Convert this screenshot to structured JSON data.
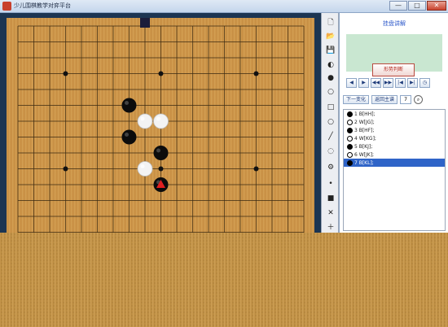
{
  "window": {
    "title": "少儿围棋教学对弈平台",
    "min_label": "—",
    "max_label": "□",
    "close_label": "✕"
  },
  "board": {
    "size": 19,
    "stones": [
      {
        "color": "black",
        "col": 7,
        "row": 5
      },
      {
        "color": "white",
        "col": 8,
        "row": 6
      },
      {
        "color": "white",
        "col": 9,
        "row": 6
      },
      {
        "color": "black",
        "col": 7,
        "row": 7
      },
      {
        "color": "black",
        "col": 9,
        "row": 8
      },
      {
        "color": "white",
        "col": 8,
        "row": 9
      },
      {
        "color": "black",
        "col": 9,
        "row": 10
      }
    ],
    "last_move_marker": {
      "col": 9,
      "row": 10
    },
    "top_marker": {
      "col": 8,
      "row": 0
    },
    "star_points": [
      [
        3,
        3
      ],
      [
        9,
        3
      ],
      [
        15,
        3
      ],
      [
        3,
        9
      ],
      [
        9,
        9
      ],
      [
        15,
        9
      ]
    ]
  },
  "toolbar": {
    "icons": [
      "new-file-icon",
      "open-folder-icon",
      "save-icon",
      "black-white-toggle-icon",
      "black-stone-icon",
      "white-stone-icon",
      "square-icon",
      "circle-icon",
      "line-icon",
      "lasso-icon",
      "settings-icon",
      "black-stone-small-icon",
      "square-mark-icon",
      "delete-icon",
      "plus-icon"
    ],
    "glyphs": [
      "🗋",
      "📂",
      "💾",
      "◐",
      "●",
      "○",
      "□",
      "○",
      "╱",
      "◌",
      "⚙",
      "•",
      "■",
      "✕",
      "＋"
    ]
  },
  "panel": {
    "title": "挂盘讲解",
    "judge_button": "形势判断",
    "nav_buttons": [
      "◀",
      "▶",
      "◀◀",
      "▶▶",
      "|◀",
      "▶|",
      "◷"
    ],
    "prev_variation": "下一变化",
    "main_line": "返回主谱",
    "move_number": "7",
    "moves": [
      {
        "color": "b",
        "text": "1 B[HH];"
      },
      {
        "color": "w",
        "text": "2 W[JG];"
      },
      {
        "color": "b",
        "text": "3 B[HF];"
      },
      {
        "color": "w",
        "text": "4 W[KG];"
      },
      {
        "color": "b",
        "text": "5 B[KJ];"
      },
      {
        "color": "w",
        "text": "6 W[JK];"
      },
      {
        "color": "b",
        "text": "7 B[KL];",
        "selected": true
      }
    ]
  }
}
